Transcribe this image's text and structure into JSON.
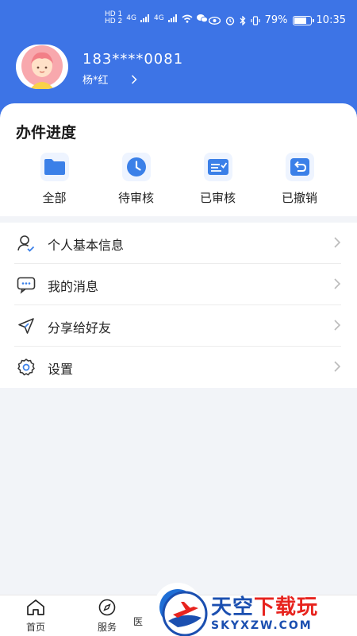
{
  "status_bar": {
    "time": "10:35",
    "battery": "79%",
    "battery_level": 0.79,
    "sim1": "HD 1",
    "sim2": "HD 2",
    "net1": "4G",
    "net2": "4G"
  },
  "user": {
    "phone": "183****0081",
    "name": "杨*红"
  },
  "progress": {
    "title": "办件进度",
    "items": [
      {
        "label": "全部",
        "icon": "folder-icon"
      },
      {
        "label": "待审核",
        "icon": "clock-icon"
      },
      {
        "label": "已审核",
        "icon": "approved-icon"
      },
      {
        "label": "已撤销",
        "icon": "undo-icon"
      }
    ]
  },
  "menu": [
    {
      "label": "个人基本信息",
      "icon": "user-icon"
    },
    {
      "label": "我的消息",
      "icon": "message-icon"
    },
    {
      "label": "分享给好友",
      "icon": "share-icon"
    },
    {
      "label": "设置",
      "icon": "settings-icon"
    }
  ],
  "tabbar": [
    {
      "label": "首页",
      "icon": "home-icon"
    },
    {
      "label": "服务",
      "icon": "compass-icon"
    },
    {
      "label": "医",
      "icon": "medical-icon"
    }
  ],
  "watermark": {
    "title_a": "天空",
    "title_b": "下载玩",
    "subtitle": "SKYXZW.COM"
  },
  "colors": {
    "primary": "#3d74e6",
    "icon_blue": "#3b80e8",
    "background": "#f2f4f8"
  }
}
